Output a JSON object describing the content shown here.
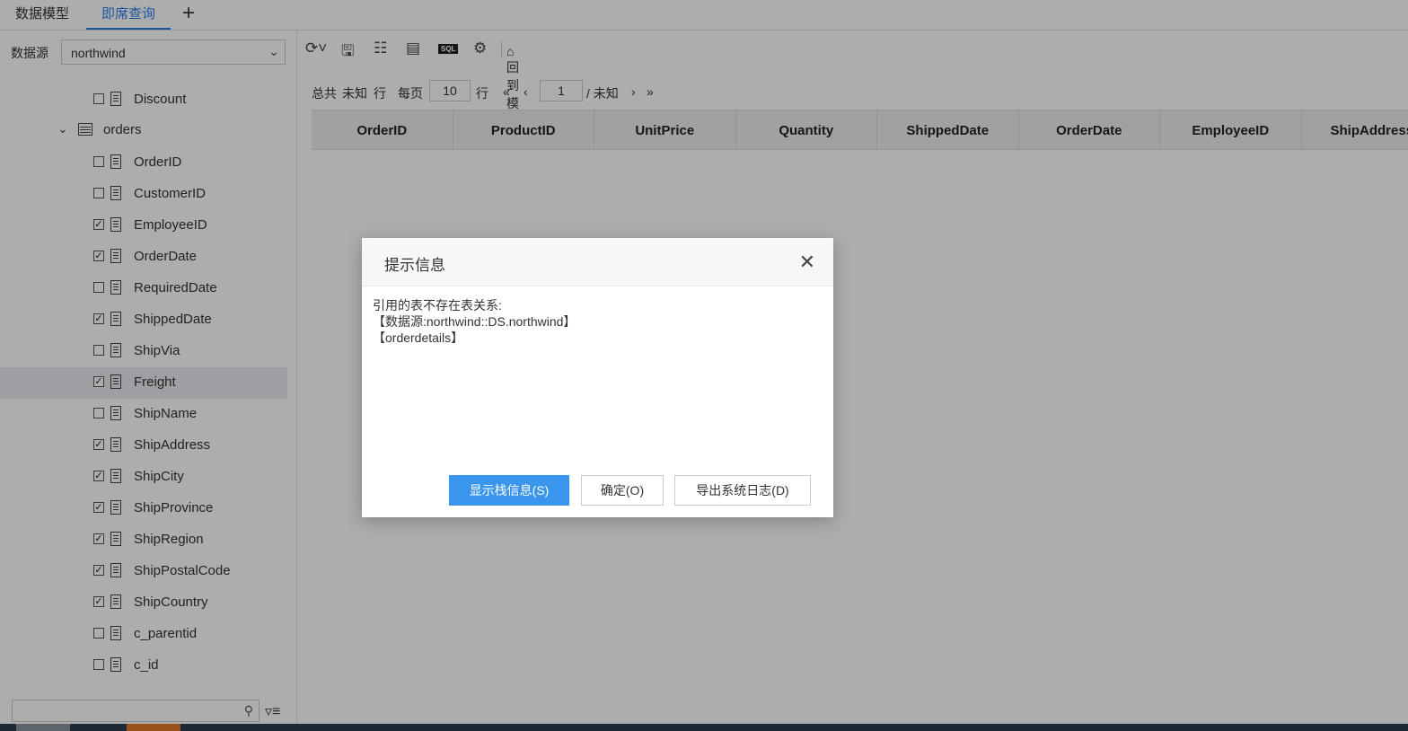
{
  "tabs": [
    {
      "label": "数据模型",
      "active": false
    },
    {
      "label": "即席查询",
      "active": true
    }
  ],
  "add_tab_icon": "plus-icon",
  "datasource": {
    "label": "数据源",
    "value": "northwind"
  },
  "tree": {
    "first_field": {
      "name": "Discount",
      "checked": false
    },
    "table": {
      "name": "orders",
      "expanded": true
    },
    "fields": [
      {
        "name": "OrderID",
        "checked": false
      },
      {
        "name": "CustomerID",
        "checked": false
      },
      {
        "name": "EmployeeID",
        "checked": true
      },
      {
        "name": "OrderDate",
        "checked": true
      },
      {
        "name": "RequiredDate",
        "checked": false
      },
      {
        "name": "ShippedDate",
        "checked": true
      },
      {
        "name": "ShipVia",
        "checked": false
      },
      {
        "name": "Freight",
        "checked": true
      },
      {
        "name": "ShipName",
        "checked": false
      },
      {
        "name": "ShipAddress",
        "checked": true
      },
      {
        "name": "ShipCity",
        "checked": true
      },
      {
        "name": "ShipProvince",
        "checked": true
      },
      {
        "name": "ShipRegion",
        "checked": true
      },
      {
        "name": "ShipPostalCode",
        "checked": true
      },
      {
        "name": "ShipCountry",
        "checked": true
      },
      {
        "name": "c_parentid",
        "checked": false
      },
      {
        "name": "c_id",
        "checked": false
      }
    ]
  },
  "toolbar": {
    "back_to_model": "回到模型",
    "sql": "SQL"
  },
  "pager": {
    "total_prefix": "总共",
    "total_value": "未知",
    "total_suffix": "行",
    "per_page_label": "每页",
    "per_page": "10",
    "per_page_suffix": "行",
    "page": "1",
    "page_total": "/ 未知"
  },
  "grid": {
    "columns": [
      "OrderID",
      "ProductID",
      "UnitPrice",
      "Quantity",
      "ShippedDate",
      "OrderDate",
      "EmployeeID",
      "ShipAddress"
    ]
  },
  "dialog": {
    "title": "提示信息",
    "lines": [
      "引用的表不存在表关系:",
      "【数据源:northwind::DS.northwind】",
      "【orderdetails】"
    ],
    "buttons": {
      "stack": "显示栈信息(S)",
      "ok": "确定(O)",
      "export": "导出系统日志(D)"
    }
  },
  "colors": {
    "accent": "#2b7de9",
    "primary_button": "#3a95ec"
  }
}
